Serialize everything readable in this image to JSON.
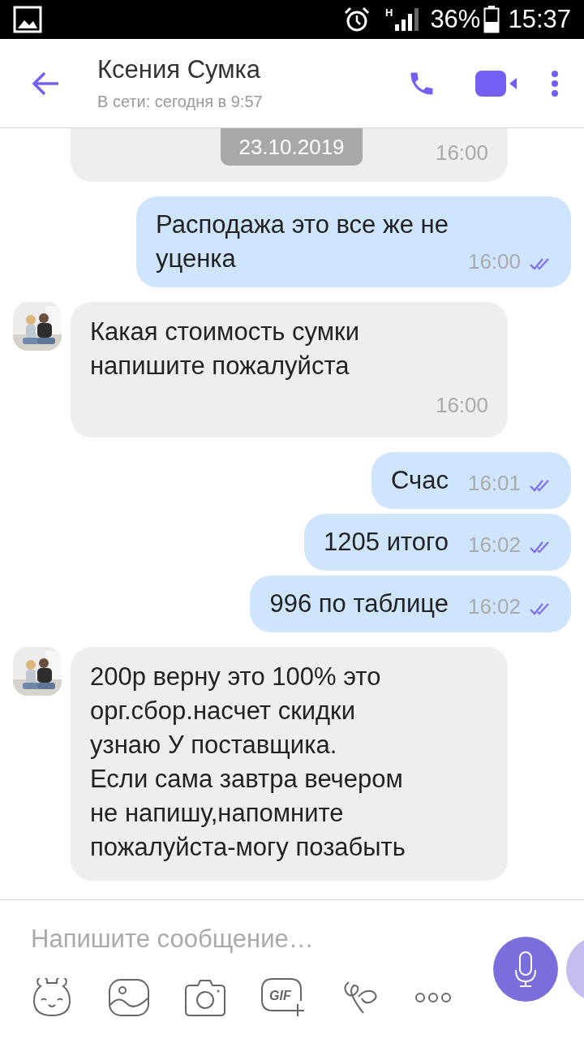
{
  "status_bar": {
    "battery": "36%",
    "time": "15:37",
    "network": "H"
  },
  "header": {
    "title": "Ксения Сумка",
    "subtitle": "В сети: сегодня в 9:57"
  },
  "date_badge": "23.10.2019",
  "messages": [
    {
      "kind": "incoming",
      "partial": true,
      "time": "16:00"
    },
    {
      "kind": "outgoing",
      "text": "Расподажа это все же не\nуценка",
      "time": "16:00",
      "read": true
    },
    {
      "kind": "incoming",
      "avatar": true,
      "text": "Какая стоимость сумки\nнапишите пожалуйста",
      "time": "16:00"
    },
    {
      "kind": "outgoing",
      "text": "Счас",
      "time": "16:01",
      "read": true
    },
    {
      "kind": "outgoing",
      "text": "1205 итого",
      "time": "16:02",
      "read": true
    },
    {
      "kind": "outgoing",
      "text": "996 по таблице",
      "time": "16:02",
      "read": true
    },
    {
      "kind": "incoming",
      "avatar": true,
      "text": "200р верну это 100% это\nорг.сбор.насчет скидки\nузнаю У поставщика.\nЕсли сама завтра вечером\nне напишу,напомните\nпожалуйста-могу позабыть"
    }
  ],
  "composer": {
    "placeholder": "Напишите сообщение…",
    "gif_label": "GIF"
  }
}
